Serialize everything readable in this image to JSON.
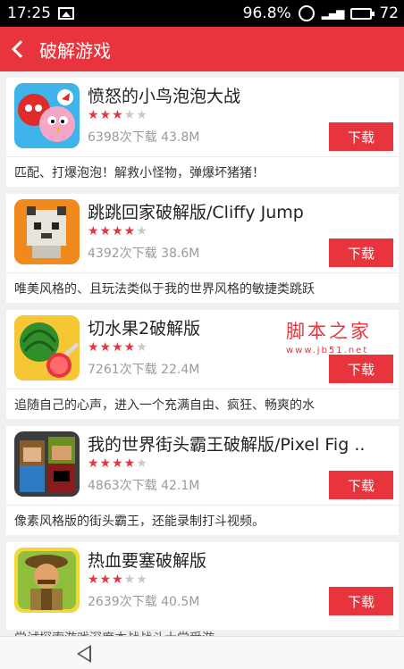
{
  "status_bar": {
    "time": "17:25",
    "battery_percent": "96.8%",
    "battery_level": "72"
  },
  "header": {
    "title": "破解游戏"
  },
  "apps": [
    {
      "name": "愤怒的小鸟泡泡大战",
      "rating": 3,
      "meta": "6398次下载 43.8M",
      "download_label": "下载",
      "description": "匹配、打爆泡泡！解救小怪物，弹爆坏猪猪！"
    },
    {
      "name": "跳跳回家破解版/Cliffy Jump",
      "rating": 4,
      "meta": "4392次下载 38.6M",
      "download_label": "下载",
      "description": "唯美风格的、且玩法类似于我的世界风格的敏捷类跳跃"
    },
    {
      "name": "切水果2破解版",
      "rating": 4,
      "meta": "7261次下载 22.4M",
      "download_label": "下载",
      "description": "追随自己的心声，进入一个充满自由、疯狂、畅爽的水"
    },
    {
      "name": "我的世界街头霸王破解版/Pixel Fig ..",
      "rating": 4,
      "meta": "4863次下载 42.1M",
      "download_label": "下载",
      "description": "像素风格版的街头霸王，还能录制打斗视频。"
    },
    {
      "name": "热血要塞破解版",
      "rating": 3,
      "meta": "2639次下载 40.5M",
      "download_label": "下载",
      "description": ""
    }
  ],
  "watermark": {
    "title": "脚本之家",
    "url": "www.jb51.net"
  },
  "bottom_partial_text": "尝试探索游戏深度本战战斗士尝受游"
}
